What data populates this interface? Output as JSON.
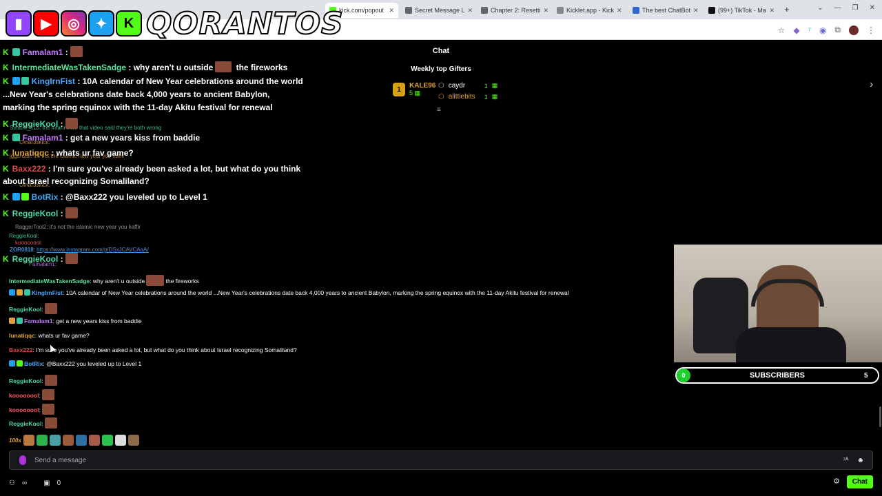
{
  "browser": {
    "tabs": [
      {
        "label": "kick.com/popout",
        "active": true
      },
      {
        "label": "Secret Message L"
      },
      {
        "label": "Chapter 2: Resetti"
      },
      {
        "label": "Kicklet.app - Kick"
      },
      {
        "label": "The best ChatBot"
      },
      {
        "label": "(99+) TikTok - Ma"
      }
    ]
  },
  "logo": {
    "text": "QORANTOS"
  },
  "chat": {
    "title": "Chat",
    "weekly_top_gifters": "Weekly top Gifters",
    "gifters": [
      {
        "rank": "1",
        "name": "KALE96",
        "count": "5"
      },
      {
        "name": "caydr",
        "count": "1"
      },
      {
        "name": "alittiebits",
        "count": "1"
      }
    ]
  },
  "overlay": {
    "lines": [
      {
        "user": "Famalam1",
        "text": " :"
      },
      {
        "user": "IntermediateWasTakenSadge",
        "text": " : why aren't u outside",
        "after": " the fireworks"
      },
      {
        "user": "KingIrnFist",
        "text": " : 10A calendar of New Year celebrations around the world"
      },
      {
        "text": "...New Year's celebrations date back 4,000 years to ancient Babylon,"
      },
      {
        "text": "marking the spring equinox with the 11-day Akitu festival for renewal"
      },
      {
        "user": "ReggieKool",
        "text": " :"
      },
      {
        "user": "Famalam1",
        "text": " : get a new years kiss from baddie"
      },
      {
        "user": "lunatiqqc",
        "text": " : whats ur fav game?"
      },
      {
        "user": "Baxx222",
        "text": " : I'm sure you've already been asked a lot, but what do you think"
      },
      {
        "text": "about Israel recognizing Somaliland?"
      },
      {
        "user": "BotRix",
        "text": " : @Baxx222 you leveled up to Level 1"
      },
      {
        "user": "ReggieKool",
        "text": " :"
      },
      {
        "user": "ReggieKool",
        "text": " :"
      }
    ],
    "ghosts": [
      {
        "text": "Sinatra_618: the imam from that video said they're both wrong"
      },
      {
        "text": "Omar3skick:"
      },
      {
        "text": "jggerdail: it's not the islamic new year you kaffir"
      },
      {
        "text": "Omar3skick:"
      },
      {
        "text": "RaggerTool2: it's not the islamic new year you kaffir"
      },
      {
        "text": "ReggieKool:"
      },
      {
        "text": "koooooool:"
      },
      {
        "user": "ZOR0818",
        "text": "https://www.instagram.com/p/DSxJCAVCAaA/"
      },
      {
        "text": "Famalam1:"
      }
    ]
  },
  "small_chat": [
    {
      "user": "IntermediateWasTakenSadge",
      "text": "why aren't u outside",
      "after": "the fireworks"
    },
    {
      "user": "KingIrnFist",
      "text": "10A calendar of New Year celebrations around the world ...New Year's celebrations date back 4,000 years to ancient Babylon, marking the spring equinox with the 11-day Akitu festival for renewal"
    },
    {
      "user": "ReggieKool",
      "text": ""
    },
    {
      "user": "Famalam1",
      "text": "get a new years kiss from baddie"
    },
    {
      "user": "lunatiqqc",
      "text": "whats ur fav game?"
    },
    {
      "user": "Baxx222",
      "text": "I'm sure you've already been asked a lot, but what do you think about Israel recognizing Somaliland?"
    },
    {
      "user": "BotRix",
      "text": "@Baxx222 you leveled up to Level 1"
    },
    {
      "user": "ReggieKool",
      "text": ""
    },
    {
      "user": "koooooool",
      "text": ""
    },
    {
      "user": "koooooool",
      "text": ""
    },
    {
      "user": "ReggieKool",
      "text": ""
    }
  ],
  "subs": {
    "start": "0",
    "label": "SUBSCRIBERS",
    "goal": "5"
  },
  "emote_row": {
    "first": "100x"
  },
  "input": {
    "placeholder": "Send a message"
  },
  "bottom": {
    "count": "0",
    "chat_button": "Chat"
  },
  "colors": {
    "kick_green": "#53fc18",
    "famalam": "#c37cff",
    "intermediate": "#5fe3a1",
    "kingirn": "#4aa8ff",
    "reggie": "#4ed9a8",
    "lunatiqqc": "#e0a33a",
    "baxx": "#e0484f",
    "botrix": "#3fa9f5",
    "koool": "#ff5b6b"
  }
}
